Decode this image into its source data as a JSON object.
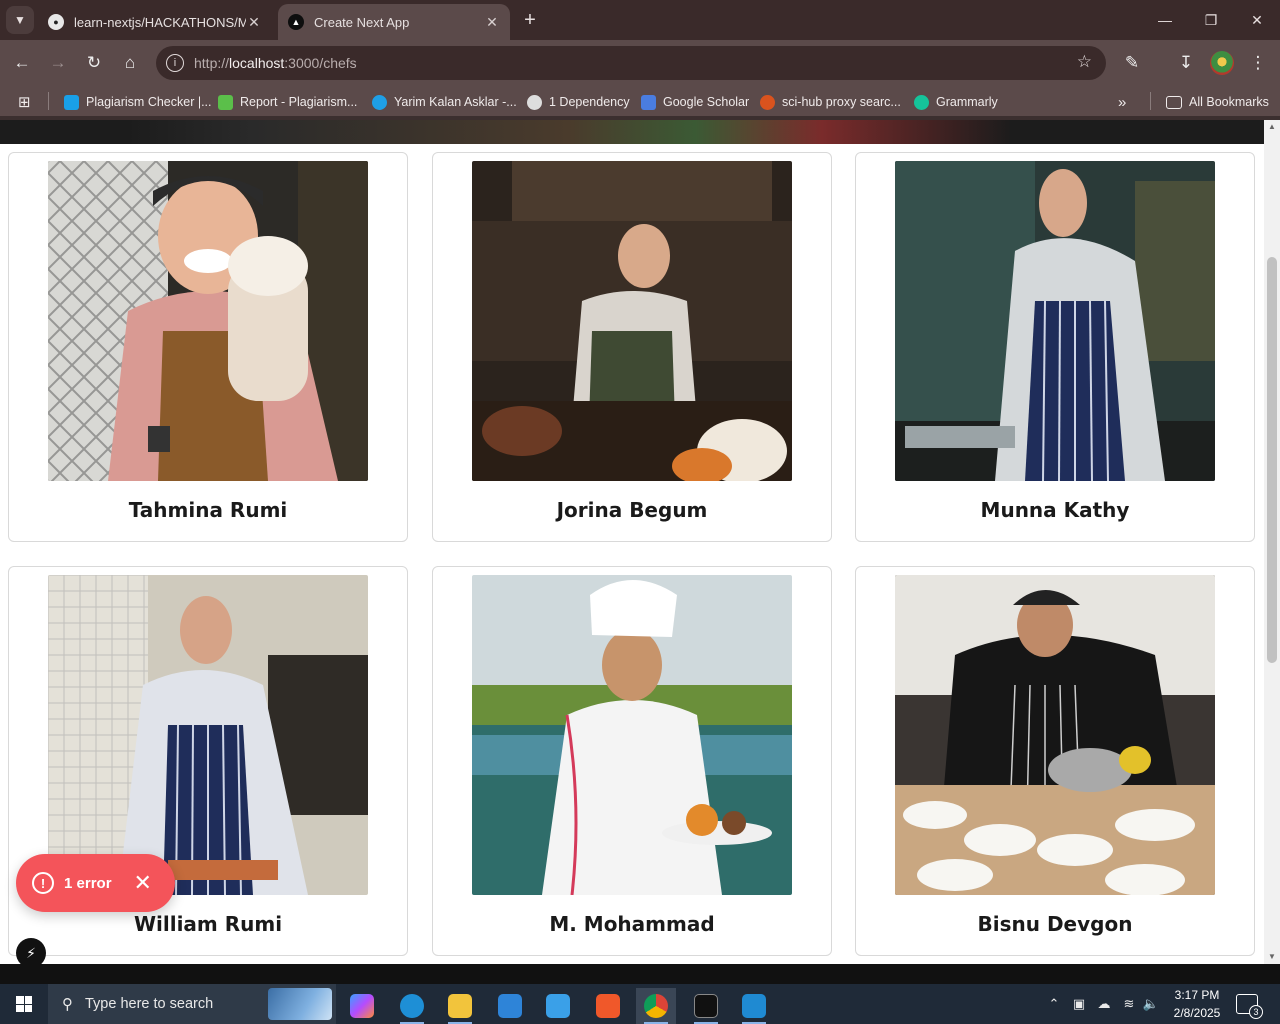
{
  "browser": {
    "tabs": [
      {
        "title": "learn-nextjs/HACKATHONS/Ma",
        "favicon": "github-icon",
        "active": false
      },
      {
        "title": "Create Next App",
        "favicon": "nextjs-triangle-icon",
        "active": true
      }
    ],
    "address": {
      "scheme": "http://",
      "host": "localhost",
      "rest": ":3000/chefs"
    },
    "bookmarks": [
      {
        "label": "Plagiarism Checker |...",
        "icon": "plagiarism-checker-icon",
        "color": "#19a0e8"
      },
      {
        "label": "Report - Plagiarism...",
        "icon": "pp-icon",
        "color": "#5bbf4a"
      },
      {
        "label": "Yarim Kalan Asklar -...",
        "icon": "play-icon",
        "color": "#1e9fe6"
      },
      {
        "label": "1 Dependency",
        "icon": "globe-icon",
        "color": "#dddddd"
      },
      {
        "label": "Google Scholar",
        "icon": "scholar-icon",
        "color": "#4a7de0"
      },
      {
        "label": "sci-hub proxy searc...",
        "icon": "scihub-icon",
        "color": "#d9531e"
      },
      {
        "label": "Grammarly",
        "icon": "grammarly-icon",
        "color": "#15c39a"
      }
    ],
    "all_bookmarks": "All Bookmarks"
  },
  "chefs": [
    {
      "name": "Tahmina Rumi"
    },
    {
      "name": "Jorina Begum"
    },
    {
      "name": "Munna Kathy"
    },
    {
      "name": "William Rumi"
    },
    {
      "name": "M. Mohammad"
    },
    {
      "name": "Bisnu Devgon"
    }
  ],
  "dev_overlay": {
    "error_label": "1 error"
  },
  "taskbar": {
    "search_placeholder": "Type here to search",
    "time": "3:17 PM",
    "date": "2/8/2025",
    "notification_count": "3"
  }
}
